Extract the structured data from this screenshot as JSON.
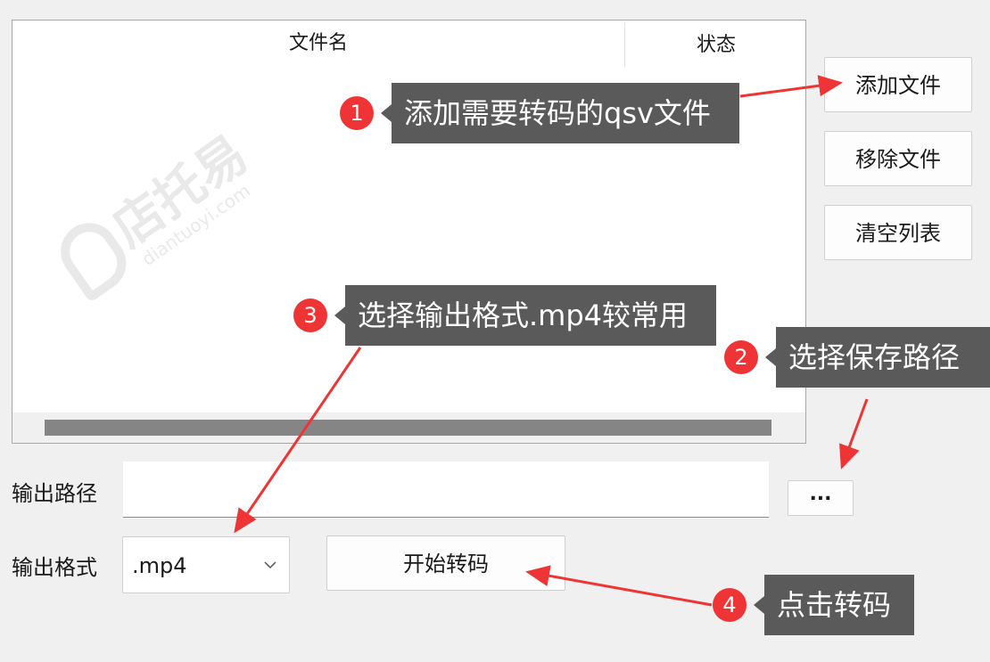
{
  "file_list": {
    "columns": [
      "文件名",
      "状态"
    ]
  },
  "buttons": {
    "add_file": "添加文件",
    "remove_file": "移除文件",
    "clear_list": "清空列表",
    "browse": "...",
    "start_convert": "开始转码"
  },
  "output": {
    "path_label": "输出路径",
    "path_value": "",
    "format_label": "输出格式",
    "format_value": ".mp4"
  },
  "watermark": {
    "text": "店托易",
    "sub": "diantuoyi.com"
  },
  "annotations": [
    {
      "number": "1",
      "text": "添加需要转码的qsv文件"
    },
    {
      "number": "2",
      "text": "选择保存路径"
    },
    {
      "number": "3",
      "text": "选择输出格式.mp4较常用"
    },
    {
      "number": "4",
      "text": "点击转码"
    }
  ],
  "colors": {
    "background": "#f0f0f0",
    "badge": "#ee3434",
    "callout": "#5a5a5a",
    "arrow": "#ee3434"
  }
}
